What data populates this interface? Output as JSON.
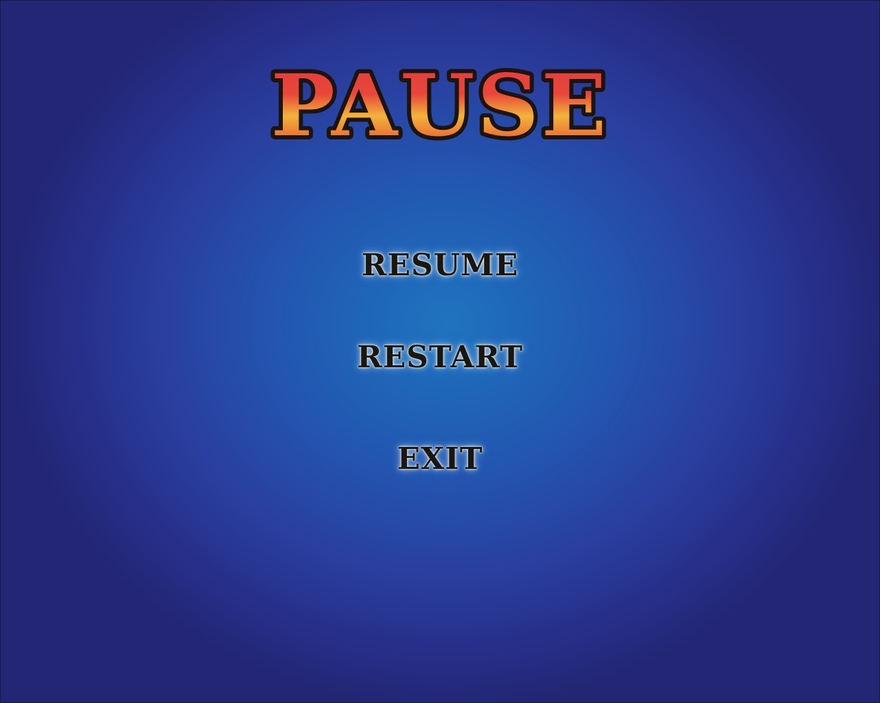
{
  "title": "PAUSE",
  "menu": {
    "resume_label": "RESUME",
    "restart_label": "RESTART",
    "exit_label": "EXIT"
  },
  "colors": {
    "title_fill_top": "#e83a3a",
    "title_fill_mid": "#f0b23a",
    "title_outline": "#1c1410",
    "menu_text": "#1a1612",
    "menu_glow": "#fffbe6",
    "background_center": "#1f74bf",
    "background_edge": "#232674"
  }
}
